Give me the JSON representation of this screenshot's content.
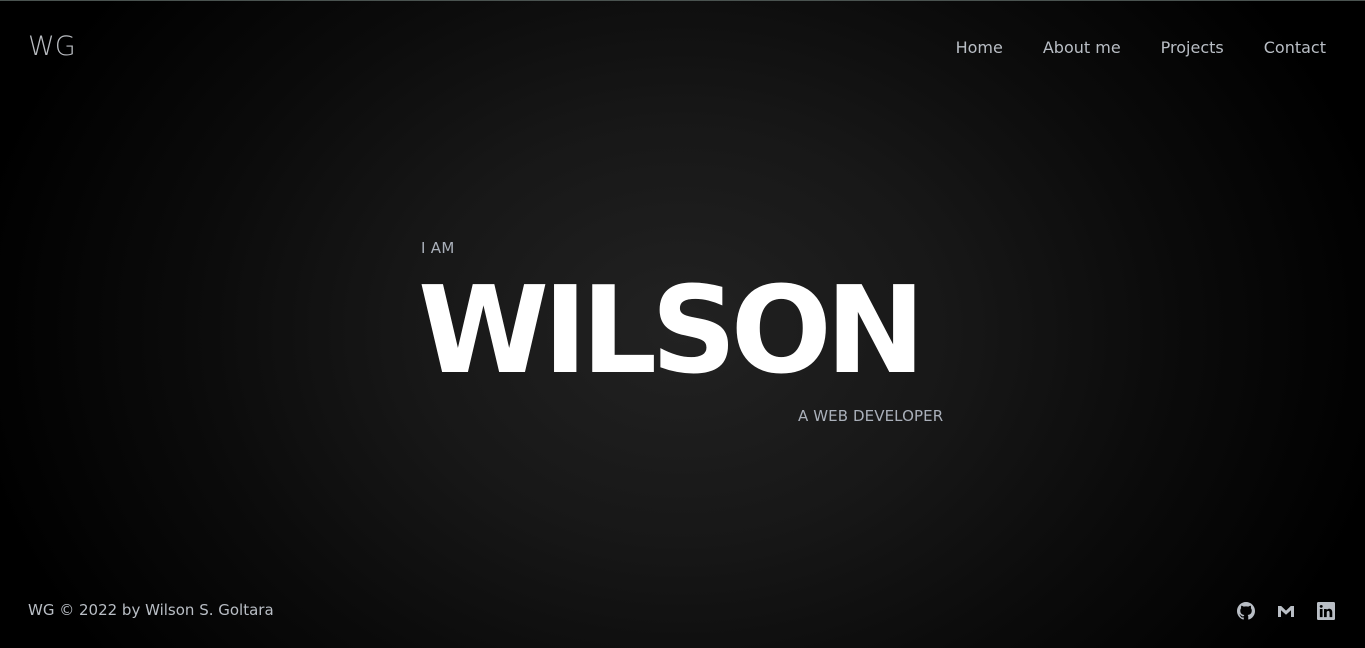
{
  "header": {
    "logo": "WG",
    "nav": [
      {
        "label": "Home"
      },
      {
        "label": "About me"
      },
      {
        "label": "Projects"
      },
      {
        "label": "Contact"
      }
    ]
  },
  "hero": {
    "intro": "I AM",
    "name": "WILSON",
    "role": "A WEB DEVELOPER"
  },
  "footer": {
    "copyright": "WG © 2022 by Wilson S. Goltara",
    "socials": [
      {
        "icon": "github-icon"
      },
      {
        "icon": "gmail-icon"
      },
      {
        "icon": "linkedin-icon"
      }
    ]
  },
  "colors": {
    "background": "#000000",
    "text": "#b9bec5",
    "hero_name": "#ffffff",
    "accent_line": "#4a5350"
  }
}
